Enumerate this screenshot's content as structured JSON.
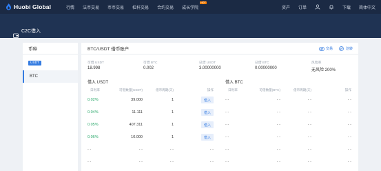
{
  "nav": {
    "brand": "Huobi Global",
    "links": [
      {
        "label": "行情"
      },
      {
        "label": "法币交易"
      },
      {
        "label": "币币交易"
      },
      {
        "label": "杠杆交易"
      },
      {
        "label": "合约交易"
      },
      {
        "label": "成长学院",
        "badge": "HOT"
      }
    ],
    "right": {
      "assets": "资产",
      "orders": "订单",
      "download": "下载",
      "language": "简体中文"
    }
  },
  "hero": {
    "title": "C2C借入"
  },
  "left_panel": {
    "header": "币种",
    "tag": "USDT",
    "selected_coin": "BTC"
  },
  "right_panel": {
    "title": "BTC/USDT 借币账户",
    "actions": {
      "exchange": "交易",
      "transfer": "划转"
    },
    "summary": [
      {
        "label": "可借 USDT",
        "value": "18.998"
      },
      {
        "label": "可借 BTC",
        "value": "0.002"
      },
      {
        "label": "已借 USDT",
        "value": "3.00000000"
      },
      {
        "label": "已借 BTC",
        "value": "0.00000000"
      },
      {
        "label": "风险率",
        "value": "无风险 200%"
      }
    ],
    "left_table": {
      "title": "借入 USDT",
      "headers": [
        "日利率",
        "可借数量(USDT)",
        "借币周期(天)",
        "操作"
      ],
      "rows": [
        {
          "rate": "0.02%",
          "amount": "39.000",
          "days": "1",
          "action": "借入"
        },
        {
          "rate": "0.04%",
          "amount": "11.111",
          "days": "1",
          "action": "借入"
        },
        {
          "rate": "0.05%",
          "amount": "407.311",
          "days": "1",
          "action": "借入"
        },
        {
          "rate": "0.06%",
          "amount": "10.000",
          "days": "1",
          "action": "借入"
        },
        {
          "rate": "- -",
          "amount": "- -",
          "days": "- -",
          "action": "- -"
        },
        {
          "rate": "- -",
          "amount": "- -",
          "days": "- -",
          "action": "- -"
        }
      ]
    },
    "right_table": {
      "title": "借入 BTC",
      "headers": [
        "日利率",
        "可借数量(BTC)",
        "借币周期(天)",
        "操作"
      ],
      "rows": [
        {
          "rate": "- -",
          "amount": "- -",
          "days": "- -",
          "action": "- -"
        },
        {
          "rate": "- -",
          "amount": "- -",
          "days": "- -",
          "action": "- -"
        },
        {
          "rate": "- -",
          "amount": "- -",
          "days": "- -",
          "action": "- -"
        },
        {
          "rate": "- -",
          "amount": "- -",
          "days": "- -",
          "action": "- -"
        },
        {
          "rate": "- -",
          "amount": "- -",
          "days": "- -",
          "action": "- -"
        },
        {
          "rate": "- -",
          "amount": "- -",
          "days": "- -",
          "action": "- -"
        }
      ]
    }
  },
  "colors": {
    "nav_bg": "#1b2a44",
    "hero_bg": "#1f3353",
    "accent": "#357ce1",
    "green": "#29a86a",
    "badge": "#ff7d00"
  },
  "icons": {
    "user": "user-icon",
    "bell": "bell-icon",
    "wallet": "wallet-icon",
    "exchange": "exchange-icon",
    "transfer": "transfer-icon",
    "logo": "flame-logo-icon"
  }
}
